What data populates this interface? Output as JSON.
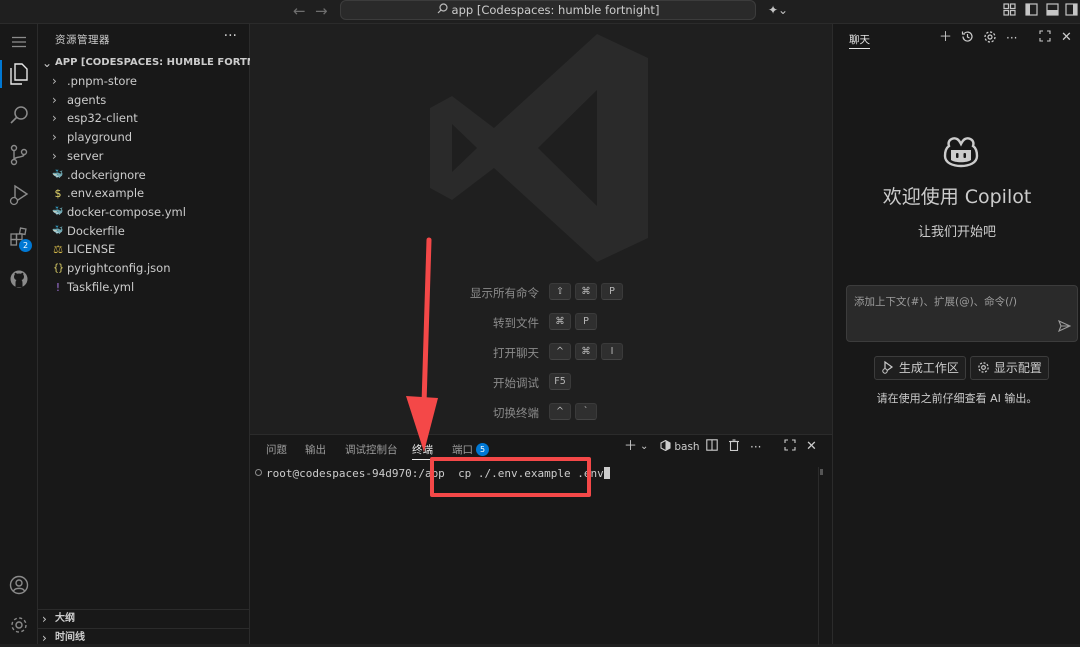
{
  "titlebar": {
    "search_text": "app [Codespaces: humble fortnight]"
  },
  "activitybar": {
    "extensions_badge": "2"
  },
  "sidebar": {
    "header": "资源管理器",
    "more": "···",
    "root_label": "APP [CODESPACES: HUMBLE FORTNIGHT]",
    "items": [
      {
        "label": ".pnpm-store",
        "type": "folder"
      },
      {
        "label": "agents",
        "type": "folder"
      },
      {
        "label": "esp32-client",
        "type": "folder"
      },
      {
        "label": "playground",
        "type": "folder"
      },
      {
        "label": "server",
        "type": "folder"
      },
      {
        "label": ".dockerignore",
        "type": "docker"
      },
      {
        "label": ".env.example",
        "type": "env"
      },
      {
        "label": "docker-compose.yml",
        "type": "compose"
      },
      {
        "label": "Dockerfile",
        "type": "docker"
      },
      {
        "label": "LICENSE",
        "type": "license"
      },
      {
        "label": "pyrightconfig.json",
        "type": "json"
      },
      {
        "label": "Taskfile.yml",
        "type": "yml"
      }
    ],
    "outline_label": "大纲",
    "timeline_label": "时间线"
  },
  "editor": {
    "shortcuts": [
      {
        "label": "显示所有命令",
        "keys": [
          "⇧",
          "⌘",
          "P"
        ]
      },
      {
        "label": "转到文件",
        "keys": [
          "⌘",
          "P"
        ]
      },
      {
        "label": "打开聊天",
        "keys": [
          "^",
          "⌘",
          "I"
        ]
      },
      {
        "label": "开始调试",
        "keys": [
          "F5"
        ]
      },
      {
        "label": "切换终端",
        "keys": [
          "^",
          "`"
        ]
      }
    ]
  },
  "panel": {
    "tabs": [
      "问题",
      "输出",
      "调试控制台",
      "终端",
      "端口"
    ],
    "active_tab": "终端",
    "ports_badge": "5",
    "shell_name": "bash",
    "terminal": {
      "prompt": "root@codespaces-94d970:/app",
      "command": "cp ./.env.example .env"
    }
  },
  "chat": {
    "title": "聊天",
    "welcome": "欢迎使用 Copilot",
    "subtitle": "让我们开始吧",
    "input_placeholder": "添加上下文(#)、扩展(@)、命令(/)",
    "button_workspace": "生成工作区",
    "button_config": "显示配置",
    "note": "请在使用之前仔细查看 AI 输出。"
  },
  "colors": {
    "accent": "#0078d4",
    "annotation": "#f44848",
    "background": "#1f1f1f",
    "sidebar_bg": "#181818"
  }
}
